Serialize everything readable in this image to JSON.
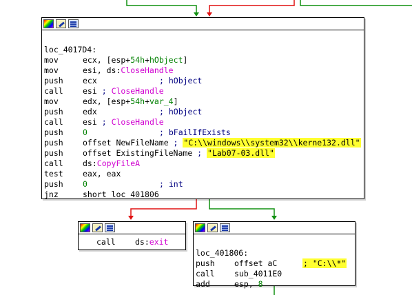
{
  "colors": {
    "edge_false": "#e01010",
    "edge_true": "#109010",
    "edge_default": "#109010",
    "highlight": "#ffff30",
    "number": "#008000",
    "import": "#d000d0",
    "comment": "#000080"
  },
  "node_icons": [
    "color-icon",
    "edit-icon",
    "graph-icon"
  ],
  "main_block": {
    "label": "loc_4017D4:",
    "lines": [
      {
        "mn": "mov",
        "op": [
          {
            "t": "ecx, [esp+"
          },
          {
            "t": "54h",
            "k": "num"
          },
          {
            "t": "+"
          },
          {
            "t": "hObject",
            "k": "var"
          },
          {
            "t": "]"
          }
        ]
      },
      {
        "mn": "mov",
        "op": [
          {
            "t": "esi, ds:"
          },
          {
            "t": "CloseHandle",
            "k": "imp"
          }
        ]
      },
      {
        "mn": "push",
        "op": [
          {
            "t": "ecx"
          }
        ],
        "cm": [
          {
            "t": "; hObject",
            "k": "cmt"
          }
        ],
        "cm_col": "c2"
      },
      {
        "mn": "call",
        "op": [
          {
            "t": "esi"
          },
          {
            "t": " ; ",
            "k": "cmt"
          },
          {
            "t": "CloseHandle",
            "k": "imp"
          }
        ]
      },
      {
        "mn": "mov",
        "op": [
          {
            "t": "edx, [esp+"
          },
          {
            "t": "54h",
            "k": "num"
          },
          {
            "t": "+"
          },
          {
            "t": "var_4",
            "k": "var"
          },
          {
            "t": "]"
          }
        ]
      },
      {
        "mn": "push",
        "op": [
          {
            "t": "edx"
          }
        ],
        "cm": [
          {
            "t": "; hObject",
            "k": "cmt"
          }
        ],
        "cm_col": "c2"
      },
      {
        "mn": "call",
        "op": [
          {
            "t": "esi"
          },
          {
            "t": " ; ",
            "k": "cmt"
          },
          {
            "t": "CloseHandle",
            "k": "imp"
          }
        ]
      },
      {
        "mn": "push",
        "op": [
          {
            "t": "0",
            "k": "num"
          }
        ],
        "cm": [
          {
            "t": "; bFailIfExists",
            "k": "cmt"
          }
        ],
        "cm_col": "c2"
      },
      {
        "mn": "push",
        "op": [
          {
            "t": "offset NewFileName"
          },
          {
            "t": " ; ",
            "k": "cmt"
          },
          {
            "t": "\"C:\\\\windows\\\\system32\\\\kerne132.dll\"",
            "k": "str"
          }
        ]
      },
      {
        "mn": "push",
        "op": [
          {
            "t": "offset ExistingFileName"
          },
          {
            "t": " ; ",
            "k": "cmt"
          },
          {
            "t": "\"Lab07-03.dll\"",
            "k": "str"
          }
        ]
      },
      {
        "mn": "call",
        "op": [
          {
            "t": "ds:"
          },
          {
            "t": "CopyFileA",
            "k": "imp"
          }
        ]
      },
      {
        "mn": "test",
        "op": [
          {
            "t": "eax, eax"
          }
        ]
      },
      {
        "mn": "push",
        "op": [
          {
            "t": "0",
            "k": "num"
          }
        ],
        "cm": [
          {
            "t": "; int",
            "k": "cmt"
          }
        ],
        "cm_col": "c2"
      },
      {
        "mn": "jnz",
        "op": [
          {
            "t": "short loc_401806"
          }
        ]
      }
    ]
  },
  "exit_block": {
    "lines": [
      {
        "mn": "call",
        "op": [
          {
            "t": "ds:"
          },
          {
            "t": "exit",
            "k": "imp"
          }
        ]
      }
    ]
  },
  "branch_block": {
    "label": "loc_401806:",
    "lines": [
      {
        "mn": "push",
        "op": [
          {
            "t": "offset aC"
          }
        ],
        "cm": [
          {
            "t": "; \"C:\\\\*\"",
            "k": "str"
          }
        ],
        "cm_col": "c3"
      },
      {
        "mn": "call",
        "op": [
          {
            "t": "sub_4011E0"
          }
        ]
      },
      {
        "mn": "add",
        "op": [
          {
            "t": "esp, "
          },
          {
            "t": "8",
            "k": "num"
          }
        ]
      }
    ]
  }
}
